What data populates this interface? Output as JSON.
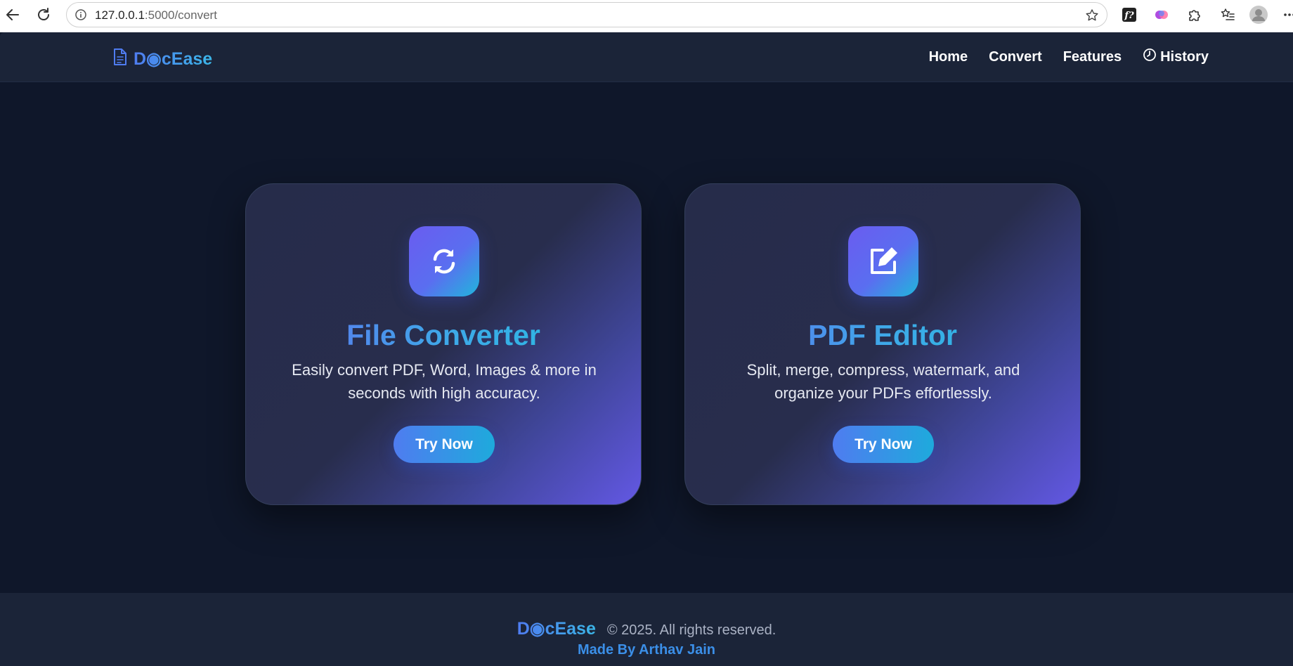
{
  "browser": {
    "url_host": "127.0.0.1",
    "url_path": ":5000/convert"
  },
  "nav": {
    "brand": "D◉cEase",
    "items": [
      {
        "label": "Home"
      },
      {
        "label": "Convert"
      },
      {
        "label": "Features"
      },
      {
        "label": "History",
        "icon": "clock-icon"
      }
    ]
  },
  "cards": [
    {
      "icon": "refresh-icon",
      "title": "File Converter",
      "description": "Easily convert PDF, Word, Images & more in seconds with high accuracy.",
      "button": "Try Now"
    },
    {
      "icon": "edit-icon",
      "title": "PDF Editor",
      "description": "Split, merge, compress, watermark, and organize your PDFs effortlessly.",
      "button": "Try Now"
    }
  ],
  "footer": {
    "brand": "D◉cEase",
    "copyright": "© 2025. All rights reserved.",
    "made_by": "Made By Arthav Jain"
  },
  "colors": {
    "page_bg": "#0f172a",
    "nav_bg": "#1b2438",
    "accent": "#4f7cf0",
    "accent_cyan": "#1eaadc",
    "card_gradient_end": "#6358e4"
  }
}
